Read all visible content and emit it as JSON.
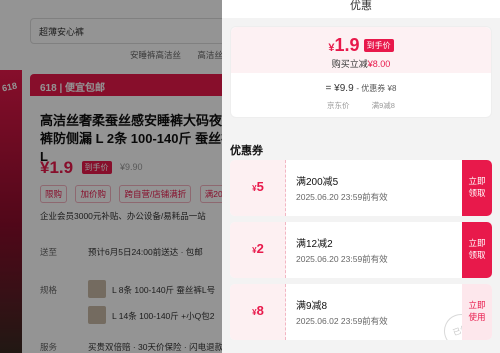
{
  "background": {
    "search_text": "超薄安心裤",
    "hints": [
      "安睡裤高洁丝",
      "高洁丝"
    ],
    "side_tag": "618",
    "promo_label": "618 | 便宜包邮",
    "product_title": "高洁丝奢柔蚕丝感安睡裤大码夜安裤防侧漏 L 2条 100-140斤 蚕丝裤L",
    "price": "¥1.9",
    "price_tag": "到手价",
    "old_price": "¥9.90",
    "chips": [
      "限购",
      "加价购",
      "跨自营/店铺满折",
      "满200"
    ],
    "member_line": "企业会员3000元补贴、办公设备/易耗品一站",
    "shipping_label": "送至",
    "shipping_value": "预计6月5日24:00前送达 · 包邮",
    "spec_label": "规格",
    "sku1": "L 8条 100-140斤 蚕丝裤L号",
    "sku2": "L 14条 100-140斤 +小Q包2",
    "service_label": "服务",
    "service_value": "买贵双倍赔 · 30天价保险 · 闪电退款"
  },
  "panel": {
    "title": "优惠",
    "summary": {
      "currency": "¥",
      "price": "1.9",
      "badge": "到手价",
      "buy_reduce_label": "购买立减",
      "buy_reduce_amount": "¥8.00",
      "calc_main": "= ¥9.9",
      "calc_minus": "- 优惠券 ¥8",
      "calc_sub_left": "京东价",
      "calc_sub_right": "满9减8"
    },
    "section_title": "优惠券",
    "coupons": [
      {
        "currency": "¥",
        "amount": "5",
        "name": "满200减5",
        "date": "2025.06.20 23:59前有效",
        "button": [
          "立即",
          "领取"
        ],
        "style": "solid"
      },
      {
        "currency": "¥",
        "amount": "2",
        "name": "满12减2",
        "date": "2025.06.20 23:59前有效",
        "button": [
          "立即",
          "领取"
        ],
        "style": "solid"
      },
      {
        "currency": "¥",
        "amount": "8",
        "name": "满9减8",
        "date": "2025.06.02 23:59前有效",
        "button": [
          "立即",
          "使用"
        ],
        "style": "light",
        "stamp": "已领"
      }
    ]
  },
  "colors": {
    "accent": "#e8194b"
  }
}
